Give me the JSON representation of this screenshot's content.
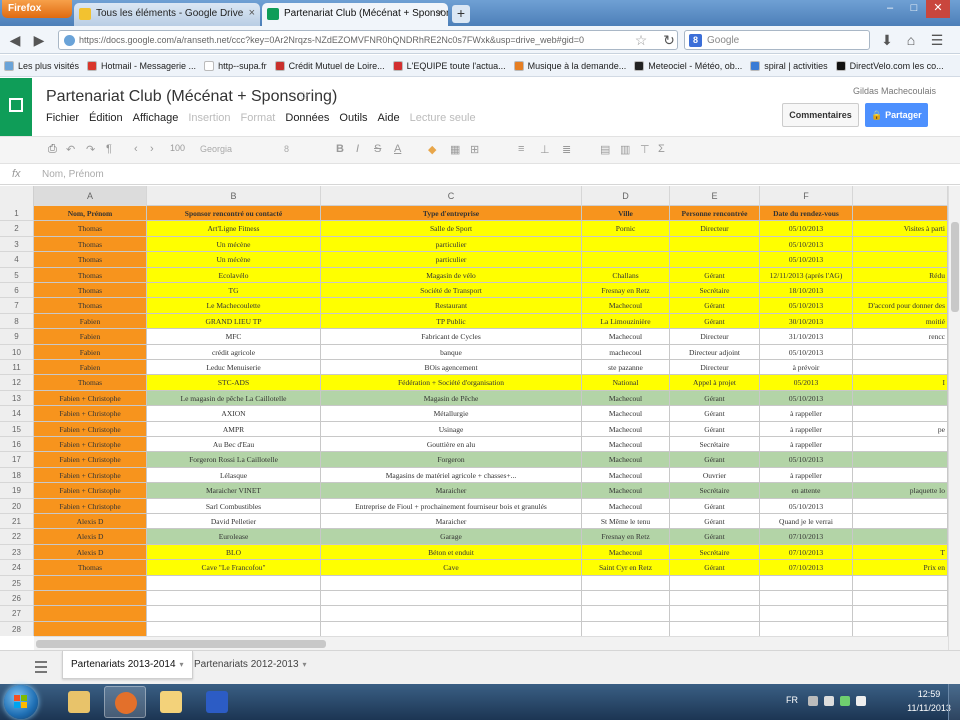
{
  "browser": {
    "app_button": "Firefox",
    "tabs": [
      {
        "title": "Tous les éléments - Google Drive",
        "active": false
      },
      {
        "title": "Partenariat Club (Mécénat + Sponsori...",
        "active": true
      }
    ],
    "url": "https://docs.google.com/a/ranseth.net/ccc?key=0Ar2Nrqzs-NZdEZOMVFNR0hQNDRhRE2Nc0s7FWxk&usp=drive_web#gid=0",
    "search_engine": "Google",
    "search_placeholder": "Google",
    "bookmarks": [
      {
        "label": "Les plus visités",
        "color": "#6aa3d8"
      },
      {
        "label": "Hotmail - Messagerie ...",
        "color": "#d9362b"
      },
      {
        "label": "http--supa.fr",
        "color": "#ffffff"
      },
      {
        "label": "Crédit Mutuel de Loire...",
        "color": "#c9302c"
      },
      {
        "label": "L'EQUIPE toute l'actua...",
        "color": "#d32f2f"
      },
      {
        "label": "Musique à la demande...",
        "color": "#e67e22"
      },
      {
        "label": "Meteociel - Météo, ob...",
        "color": "#222222"
      },
      {
        "label": "spiral | activities",
        "color": "#3a7bd5"
      },
      {
        "label": "DirectVelo.com les co...",
        "color": "#111111"
      }
    ]
  },
  "docs": {
    "title": "Partenariat Club (Mécénat + Sponsoring)",
    "user": "Gildas Machecoulais",
    "menu": [
      {
        "label": "Fichier",
        "enabled": true
      },
      {
        "label": "Édition",
        "enabled": true
      },
      {
        "label": "Affichage",
        "enabled": true
      },
      {
        "label": "Insertion",
        "enabled": false
      },
      {
        "label": "Format",
        "enabled": false
      },
      {
        "label": "Données",
        "enabled": true
      },
      {
        "label": "Outils",
        "enabled": true
      },
      {
        "label": "Aide",
        "enabled": true
      },
      {
        "label": "Lecture seule",
        "enabled": false
      }
    ],
    "comments_label": "Commentaires",
    "share_label": "Partager",
    "font": "Georgia",
    "font_size": "8",
    "zoom": "100",
    "formula_label": "fx",
    "formula_content": "Nom, Prénom"
  },
  "colors": {
    "orange": "#f7941d",
    "yellow": "#ffff00",
    "green": "#b3d4a7",
    "white": "#ffffff",
    "header_orange": "#f79646"
  },
  "grid": {
    "columns": [
      {
        "letter": "A",
        "selected": true
      },
      {
        "letter": "B",
        "selected": false
      },
      {
        "letter": "C",
        "selected": false
      },
      {
        "letter": "D",
        "selected": false
      },
      {
        "letter": "E",
        "selected": false
      },
      {
        "letter": "F",
        "selected": false
      }
    ],
    "rows": [
      {
        "num": "1",
        "hdr": true,
        "bg": "orange",
        "cells": [
          "Nom, Prénom",
          "Sponsor rencontré ou contacté",
          "Type d'entreprise",
          "Ville",
          "Personne rencontrée",
          "Date du rendez-vous",
          ""
        ]
      },
      {
        "num": "2",
        "bg": "yellow",
        "cells": [
          "Thomas",
          "Art'Ligne Fitness",
          "Salle de Sport",
          "Pornic",
          "Directeur",
          "05/10/2013",
          "Visites à parti"
        ]
      },
      {
        "num": "3",
        "bg": "yellow",
        "cells": [
          "Thomas",
          "Un mécène",
          "particulier",
          "",
          "",
          "05/10/2013",
          ""
        ]
      },
      {
        "num": "4",
        "bg": "yellow",
        "cells": [
          "Thomas",
          "Un mécène",
          "particulier",
          "",
          "",
          "05/10/2013",
          ""
        ]
      },
      {
        "num": "5",
        "bg": "yellow",
        "cells": [
          "Thomas",
          "Ecolavélo",
          "Magasin de vélo",
          "Challans",
          "Gérant",
          "12/11/2013 (après l'AG)",
          "Rédu"
        ]
      },
      {
        "num": "6",
        "bg": "yellow",
        "cells": [
          "Thomas",
          "TG",
          "Société de Transport",
          "Fresnay en Retz",
          "Secrétaire",
          "18/10/2013",
          ""
        ]
      },
      {
        "num": "7",
        "bg": "yellow",
        "cells": [
          "Thomas",
          "Le Machecoulette",
          "Restaurant",
          "Machecoul",
          "Gérant",
          "05/10/2013",
          "D'accord pour donner des"
        ]
      },
      {
        "num": "8",
        "bg": "yellow",
        "cells": [
          "Fabien",
          "GRAND LIEU TP",
          "TP Public",
          "La Limouzinière",
          "Gérant",
          "30/10/2013",
          "moitié"
        ]
      },
      {
        "num": "9",
        "bg": "white",
        "cells": [
          "Fabien",
          "MFC",
          "Fabricant de Cycles",
          "Machecoul",
          "Directeur",
          "31/10/2013",
          "rencc"
        ]
      },
      {
        "num": "10",
        "bg": "white",
        "cells": [
          "Fabien",
          "crédit agricole",
          "banque",
          "machecoul",
          "Directeur adjoint",
          "05/10/2013",
          ""
        ]
      },
      {
        "num": "11",
        "bg": "white",
        "cells": [
          "Fabien",
          "Leduc Menuiserie",
          "BOis agencement",
          "ste pazanne",
          "Directeur",
          "à prévoir",
          ""
        ]
      },
      {
        "num": "12",
        "bg": "yellow",
        "cells": [
          "Thomas",
          "STC-ADS",
          "Fédération + Société d'organisation",
          "National",
          "Appel à projet",
          "05/2013",
          "I"
        ]
      },
      {
        "num": "13",
        "bg": "green",
        "cells": [
          "Fabien + Christophe",
          "Le magasin de pêche La Caillotelle",
          "Magasin de Pêche",
          "Machecoul",
          "Gérant",
          "05/10/2013",
          ""
        ]
      },
      {
        "num": "14",
        "bg": "white",
        "cells": [
          "Fabien + Christophe",
          "AXION",
          "Métallurgie",
          "Machecoul",
          "Gérant",
          "à rappeller",
          ""
        ]
      },
      {
        "num": "15",
        "bg": "white",
        "cells": [
          "Fabien + Christophe",
          "AMPR",
          "Usinage",
          "Machecoul",
          "Gérant",
          "à rappeller",
          "pe"
        ]
      },
      {
        "num": "16",
        "bg": "white",
        "cells": [
          "Fabien + Christophe",
          "Au Bec d'Eau",
          "Gouttière en alu",
          "Machecoul",
          "Secrétaire",
          "à rappeller",
          ""
        ]
      },
      {
        "num": "17",
        "bg": "green",
        "cells": [
          "Fabien + Christophe",
          "Forgeron Rossi La Caillotelle",
          "Forgeron",
          "Machecoul",
          "Gérant",
          "05/10/2013",
          ""
        ]
      },
      {
        "num": "18",
        "bg": "white",
        "cells": [
          "Fabien + Christophe",
          "Lélasque",
          "Magasins de matériel agricole + chasses+...",
          "Machecoul",
          "Ouvrier",
          "à rappeller",
          ""
        ]
      },
      {
        "num": "19",
        "bg": "green",
        "cells": [
          "Fabien + Christophe",
          "Maraicher VINET",
          "Maraicher",
          "Machecoul",
          "Secrétaire",
          "en attente",
          "plaquette lo"
        ]
      },
      {
        "num": "20",
        "bg": "white",
        "cells": [
          "Fabien + Christophe",
          "Sarl Combustibles",
          "Entreprise de Fioul + prochainement fourniseur bois et granulés",
          "Machecoul",
          "Gérant",
          "05/10/2013",
          ""
        ]
      },
      {
        "num": "21",
        "bg": "white",
        "cells": [
          "Alexis D",
          "David Pelletier",
          "Maraicher",
          "St Même le tenu",
          "Gérant",
          "Quand je le verrai",
          ""
        ]
      },
      {
        "num": "22",
        "bg": "green",
        "cells": [
          "Alexis D",
          "Eurolease",
          "Garage",
          "Fresnay en Retz",
          "Gérant",
          "07/10/2013",
          ""
        ]
      },
      {
        "num": "23",
        "bg": "yellow",
        "cells": [
          "Alexis D",
          "BLO",
          "Béton et enduit",
          "Machecoul",
          "Secrétaire",
          "07/10/2013",
          "T"
        ]
      },
      {
        "num": "24",
        "bg": "yellow",
        "cells": [
          "Thomas",
          "Cave \"Le Francofou\"",
          "Cave",
          "Saint Cyr en Retz",
          "Gérant",
          "07/10/2013",
          "Prix en"
        ]
      },
      {
        "num": "25",
        "bg": "white",
        "cells": [
          "",
          "",
          "",
          "",
          "",
          "",
          ""
        ]
      },
      {
        "num": "26",
        "bg": "white",
        "cells": [
          "",
          "",
          "",
          "",
          "",
          "",
          ""
        ]
      },
      {
        "num": "27",
        "bg": "white",
        "cells": [
          "",
          "",
          "",
          "",
          "",
          "",
          ""
        ]
      },
      {
        "num": "28",
        "bg": "white",
        "cells": [
          "",
          "",
          "",
          "",
          "",
          "",
          ""
        ]
      }
    ]
  },
  "sheet_tabs": [
    {
      "label": "Partenariats 2013-2014",
      "active": true
    },
    {
      "label": "Partenariats 2012-2013",
      "active": false
    }
  ],
  "taskbar": {
    "apps": [
      {
        "name": "explorer",
        "color": "#e8c36a",
        "active": false
      },
      {
        "name": "firefox",
        "color": "#e3702b",
        "active": true
      },
      {
        "name": "folder",
        "color": "#f3d27a",
        "active": false
      },
      {
        "name": "screen-recorder",
        "color": "#2c5cc5",
        "active": false
      }
    ],
    "language": "FR",
    "time": "12:59",
    "date": "11/11/2013"
  }
}
